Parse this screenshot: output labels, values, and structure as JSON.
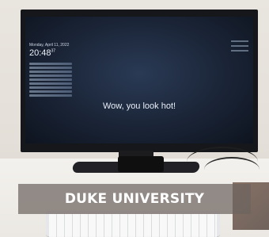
{
  "screen": {
    "date": "Monday, April 11, 2022",
    "time": "20:48",
    "time_seconds": "37",
    "compliment": "Wow, you look hot!"
  },
  "caption": "DUKE UNIVERSITY"
}
